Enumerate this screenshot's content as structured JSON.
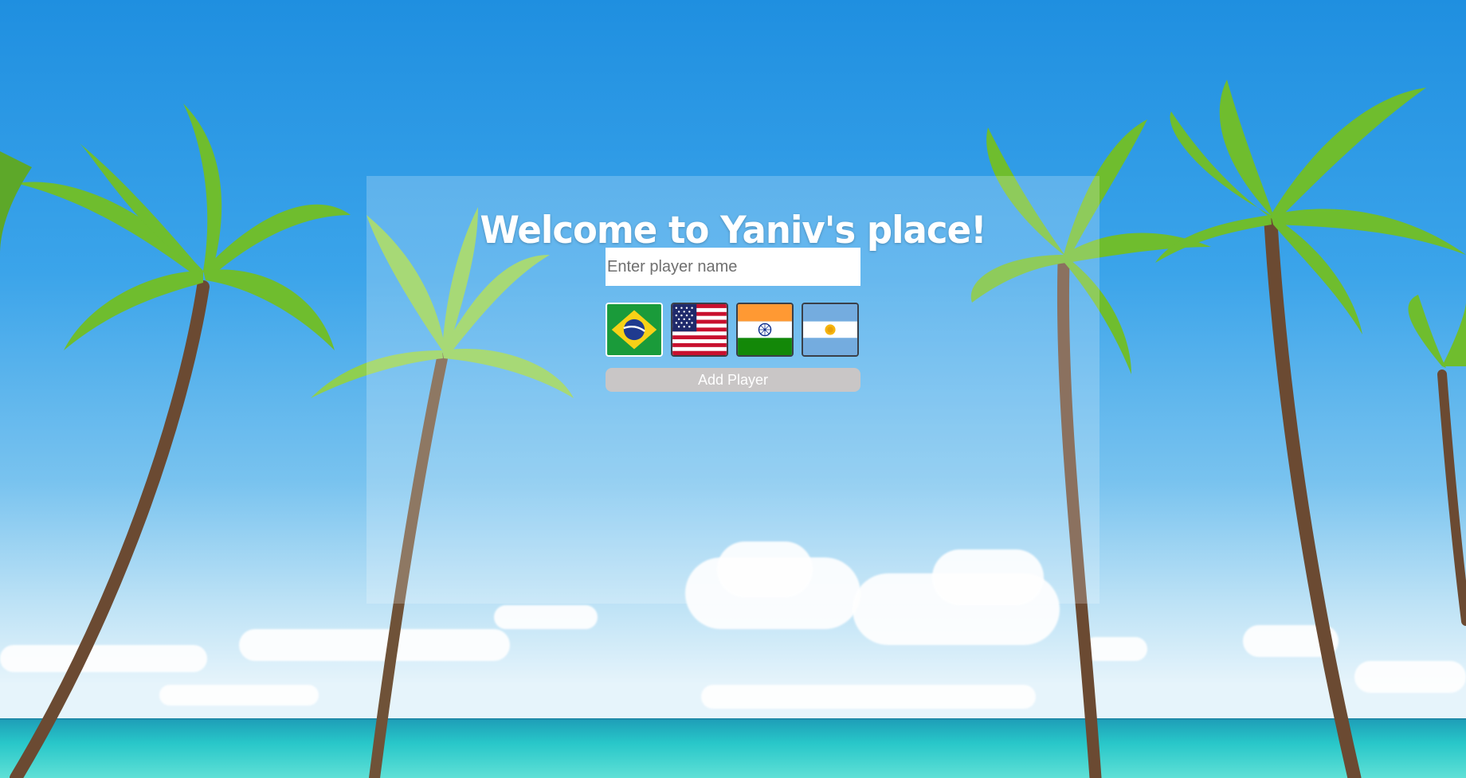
{
  "app": {
    "title": "Welcome to Yaniv's place!"
  },
  "form": {
    "name_placeholder": "Enter player name",
    "name_value": "",
    "add_button_label": "Add Player"
  },
  "flags": [
    {
      "country": "Brazil",
      "icon": "brazil-flag-icon",
      "selected": true
    },
    {
      "country": "United States",
      "icon": "usa-flag-icon",
      "selected": false
    },
    {
      "country": "India",
      "icon": "india-flag-icon",
      "selected": false
    },
    {
      "country": "Argentina",
      "icon": "argentina-flag-icon",
      "selected": false
    }
  ],
  "colors": {
    "sky": "#3ba4ea",
    "sea": "#28c7c9",
    "button_bg": "#c9c6c6",
    "button_text": "#ffffff",
    "title_text": "#ffffff"
  }
}
